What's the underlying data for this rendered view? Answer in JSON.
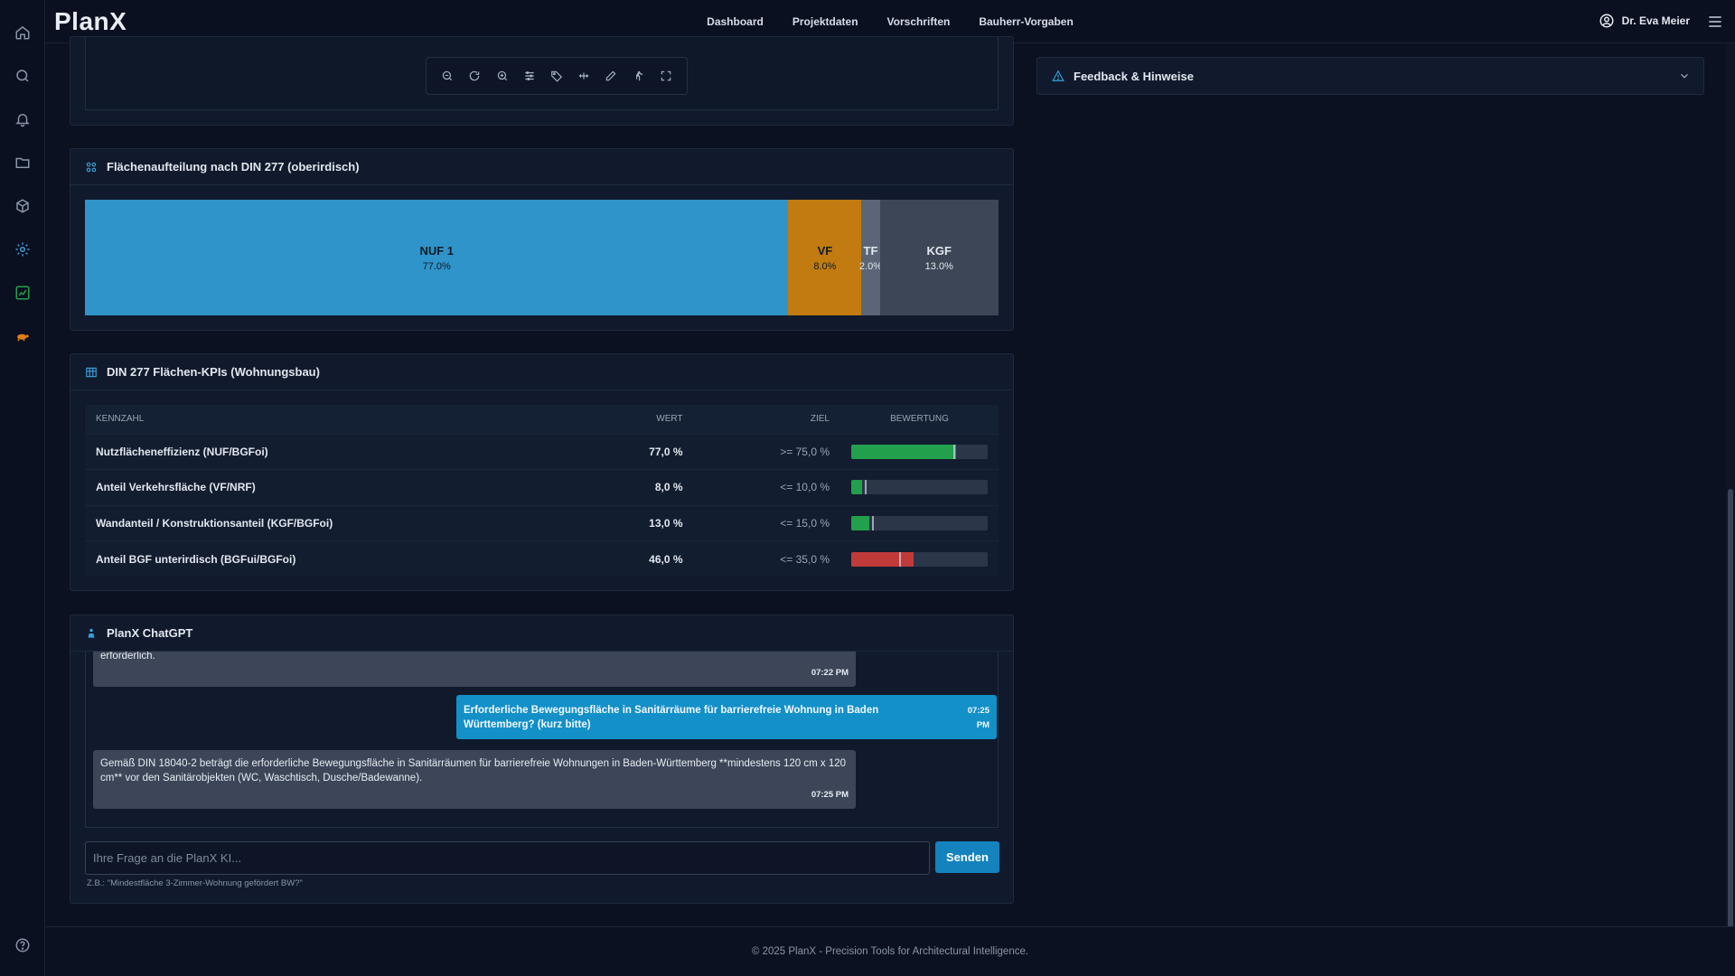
{
  "header": {
    "logo": "PlanX",
    "nav": [
      "Dashboard",
      "Projektdaten",
      "Vorschriften",
      "Bauherr-Vorgaben"
    ],
    "user_name": "Dr. Eva Meier"
  },
  "sidebar": {
    "icons": [
      "home-icon",
      "search-icon",
      "bell-icon",
      "folder-icon",
      "cube-icon",
      "gear-icon",
      "chart-icon",
      "turtle-icon",
      "help-icon"
    ]
  },
  "area_panel": {
    "title": "Flächenaufteilung nach DIN 277 (oberirdisch)"
  },
  "chart_data": {
    "type": "bar",
    "stacked": true,
    "orientation": "horizontal",
    "categories": [
      "NUF 1",
      "VF",
      "TF",
      "KGF"
    ],
    "values": [
      77.0,
      8.0,
      2.0,
      13.0
    ],
    "labels": [
      "77.0%",
      "8.0%",
      "2.0%",
      "13.0%"
    ],
    "colors": [
      "#2f94c9",
      "#c17b10",
      "#5b6577",
      "#3d4656"
    ]
  },
  "kpi_panel": {
    "title": "DIN 277 Flächen-KPIs (Wohnungsbau)",
    "columns": [
      "Kennzahl",
      "Wert",
      "Ziel",
      "Bewertung"
    ],
    "rows": [
      {
        "name": "Nutzflächeneffizienz (NUF/BGFoi)",
        "value": "77,0 %",
        "goal": ">= 75,0 %",
        "value_pct": 77.0,
        "goal_pct": 75.0,
        "status": "good",
        "color": "#22a04b"
      },
      {
        "name": "Anteil Verkehrsfläche (VF/NRF)",
        "value": "8,0 %",
        "goal": "<= 10,0 %",
        "value_pct": 8.0,
        "goal_pct": 10.0,
        "status": "good",
        "color": "#22a04b"
      },
      {
        "name": "Wandanteil / Konstruktionsanteil (KGF/BGFoi)",
        "value": "13,0 %",
        "goal": "<= 15,0 %",
        "value_pct": 13.0,
        "goal_pct": 15.0,
        "status": "good",
        "color": "#22a04b"
      },
      {
        "name": "Anteil BGF unterirdisch (BGFui/BGFoi)",
        "value": "46,0 %",
        "goal": "<= 35,0 %",
        "value_pct": 46.0,
        "goal_pct": 35.0,
        "status": "bad",
        "color": "#c13a3a"
      }
    ]
  },
  "chat": {
    "title": "PlanX ChatGPT",
    "messages": [
      {
        "role": "bot",
        "text": "erforderlich.",
        "time": "07:22 PM"
      },
      {
        "role": "user",
        "text": "Erforderliche Bewegungsfläche in Sanitärräume für barrierefreie Wohnung in Baden Württemberg? (kurz bitte)",
        "time": "07:25 PM"
      },
      {
        "role": "bot",
        "text": "Gemäß DIN 18040-2 beträgt die erforderliche Bewegungsfläche in Sanitärräumen für barrierefreie Wohnungen in Baden-Württemberg **mindestens 120 cm x 120 cm** vor den Sanitärobjekten (WC, Waschtisch, Dusche/Badewanne).",
        "time": "07:25 PM"
      }
    ],
    "input_placeholder": "Ihre Frage an die PlanX KI...",
    "send_label": "Senden",
    "hint": "Z.B.: \"Mindestfläche 3-Zimmer-Wohnung gefördert BW?\""
  },
  "feedback": {
    "title": "Feedback & Hinweise"
  },
  "footer": {
    "text": "© 2025 PlanX - Precision Tools for Architectural Intelligence."
  }
}
